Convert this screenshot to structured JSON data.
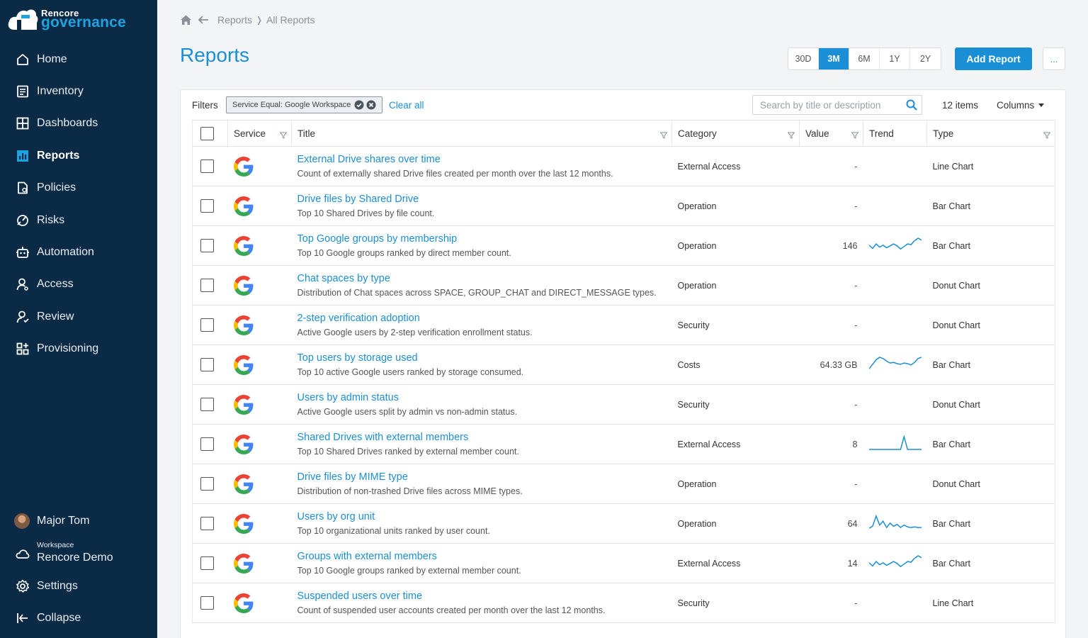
{
  "app": {
    "brand_top": "Rencore",
    "brand_bottom": "governance"
  },
  "sidebar": {
    "items": [
      {
        "label": "Home",
        "icon": "home-icon"
      },
      {
        "label": "Inventory",
        "icon": "inventory-icon"
      },
      {
        "label": "Dashboards",
        "icon": "dashboards-icon"
      },
      {
        "label": "Reports",
        "icon": "reports-icon",
        "active": true
      },
      {
        "label": "Policies",
        "icon": "policies-icon"
      },
      {
        "label": "Risks",
        "icon": "risks-icon"
      },
      {
        "label": "Automation",
        "icon": "automation-icon"
      },
      {
        "label": "Access",
        "icon": "access-icon"
      },
      {
        "label": "Review",
        "icon": "review-icon"
      },
      {
        "label": "Provisioning",
        "icon": "provisioning-icon"
      }
    ],
    "user": "Major Tom",
    "workspace_label": "Workspace",
    "workspace_name": "Rencore Demo",
    "settings": "Settings",
    "collapse": "Collapse"
  },
  "breadcrumb": {
    "parent": "Reports",
    "current": "All Reports"
  },
  "page": {
    "title": "Reports",
    "ranges": [
      "30D",
      "3M",
      "6M",
      "1Y",
      "2Y"
    ],
    "active_range": "3M",
    "add_button": "Add Report",
    "more_button": "..."
  },
  "toolbar": {
    "filters_label": "Filters",
    "chip_label": "Service Equal: Google Workspace",
    "clear_all": "Clear all",
    "search_placeholder": "Search by title or description",
    "items_count": "12 items",
    "columns": "Columns"
  },
  "table": {
    "headers": {
      "service": "Service",
      "title": "Title",
      "category": "Category",
      "value": "Value",
      "trend": "Trend",
      "type": "Type"
    },
    "rows": [
      {
        "title": "External Drive shares over time",
        "description": "Count of externally shared Drive files created per month over the last 12 months.",
        "category": "External Access",
        "value": "-",
        "type": "Line Chart",
        "trend": null
      },
      {
        "title": "Drive files by Shared Drive",
        "description": "Top 10 Shared Drives by file count.",
        "category": "Operation",
        "value": "-",
        "type": "Bar Chart",
        "trend": null
      },
      {
        "title": "Top Google groups by membership",
        "description": "Top 10 Google groups ranked by direct member count.",
        "category": "Operation",
        "value": "146",
        "type": "Bar Chart",
        "trend": [
          0.45,
          0.2,
          0.55,
          0.3,
          0.45,
          0.25,
          0.4,
          0.55,
          0.4,
          0.15,
          0.35,
          0.55,
          0.5,
          0.8,
          1.0,
          0.85
        ]
      },
      {
        "title": "Chat spaces by type",
        "description": "Distribution of Chat spaces across SPACE, GROUP_CHAT and DIRECT_MESSAGE types.",
        "category": "Operation",
        "value": "-",
        "type": "Donut Chart",
        "trend": null
      },
      {
        "title": "2-step verification adoption",
        "description": "Active Google users by 2-step verification enrollment status.",
        "category": "Security",
        "value": "-",
        "type": "Donut Chart",
        "trend": null
      },
      {
        "title": "Top users by storage used",
        "description": "Top 10 active Google users ranked by storage consumed.",
        "category": "Costs",
        "value": "64.33 GB",
        "type": "Bar Chart",
        "trend": [
          0.1,
          0.45,
          0.8,
          1.0,
          0.9,
          0.7,
          0.55,
          0.6,
          0.5,
          0.45,
          0.55,
          0.5,
          0.4,
          0.6,
          0.9,
          1.0
        ]
      },
      {
        "title": "Users by admin status",
        "description": "Active Google users split by admin vs non-admin status.",
        "category": "Security",
        "value": "-",
        "type": "Donut Chart",
        "trend": null
      },
      {
        "title": "Shared Drives with external members",
        "description": "Top 10 Shared Drives ranked by external member count.",
        "category": "External Access",
        "value": "8",
        "type": "Bar Chart",
        "trend": [
          0,
          0,
          0,
          0,
          0,
          0,
          0,
          0,
          0,
          0,
          1.0,
          0,
          0,
          0,
          0,
          0
        ]
      },
      {
        "title": "Drive files by MIME type",
        "description": "Distribution of non-trashed Drive files across MIME types.",
        "category": "Operation",
        "value": "-",
        "type": "Donut Chart",
        "trend": null
      },
      {
        "title": "Users by org unit",
        "description": "Top 10 organizational units ranked by user count.",
        "category": "Operation",
        "value": "64",
        "type": "Bar Chart",
        "trend": [
          0.05,
          0.2,
          1.0,
          0.3,
          0.6,
          0.1,
          0.45,
          0.2,
          0.35,
          0.1,
          0.3,
          0.15,
          0.1,
          0.15,
          0.1,
          0.1
        ]
      },
      {
        "title": "Groups with external members",
        "description": "Top 10 Google groups ranked by external member count.",
        "category": "External Access",
        "value": "14",
        "type": "Bar Chart",
        "trend": [
          0.45,
          0.2,
          0.55,
          0.3,
          0.45,
          0.25,
          0.4,
          0.55,
          0.4,
          0.15,
          0.35,
          0.55,
          0.5,
          0.8,
          1.0,
          0.85
        ]
      },
      {
        "title": "Suspended users over time",
        "description": "Count of suspended user accounts created per month over the last 12 months.",
        "category": "Security",
        "value": "-",
        "type": "Line Chart",
        "trend": null
      }
    ]
  },
  "colors": {
    "sidebar": "#0b2a46",
    "accent": "#1a8fd6"
  }
}
